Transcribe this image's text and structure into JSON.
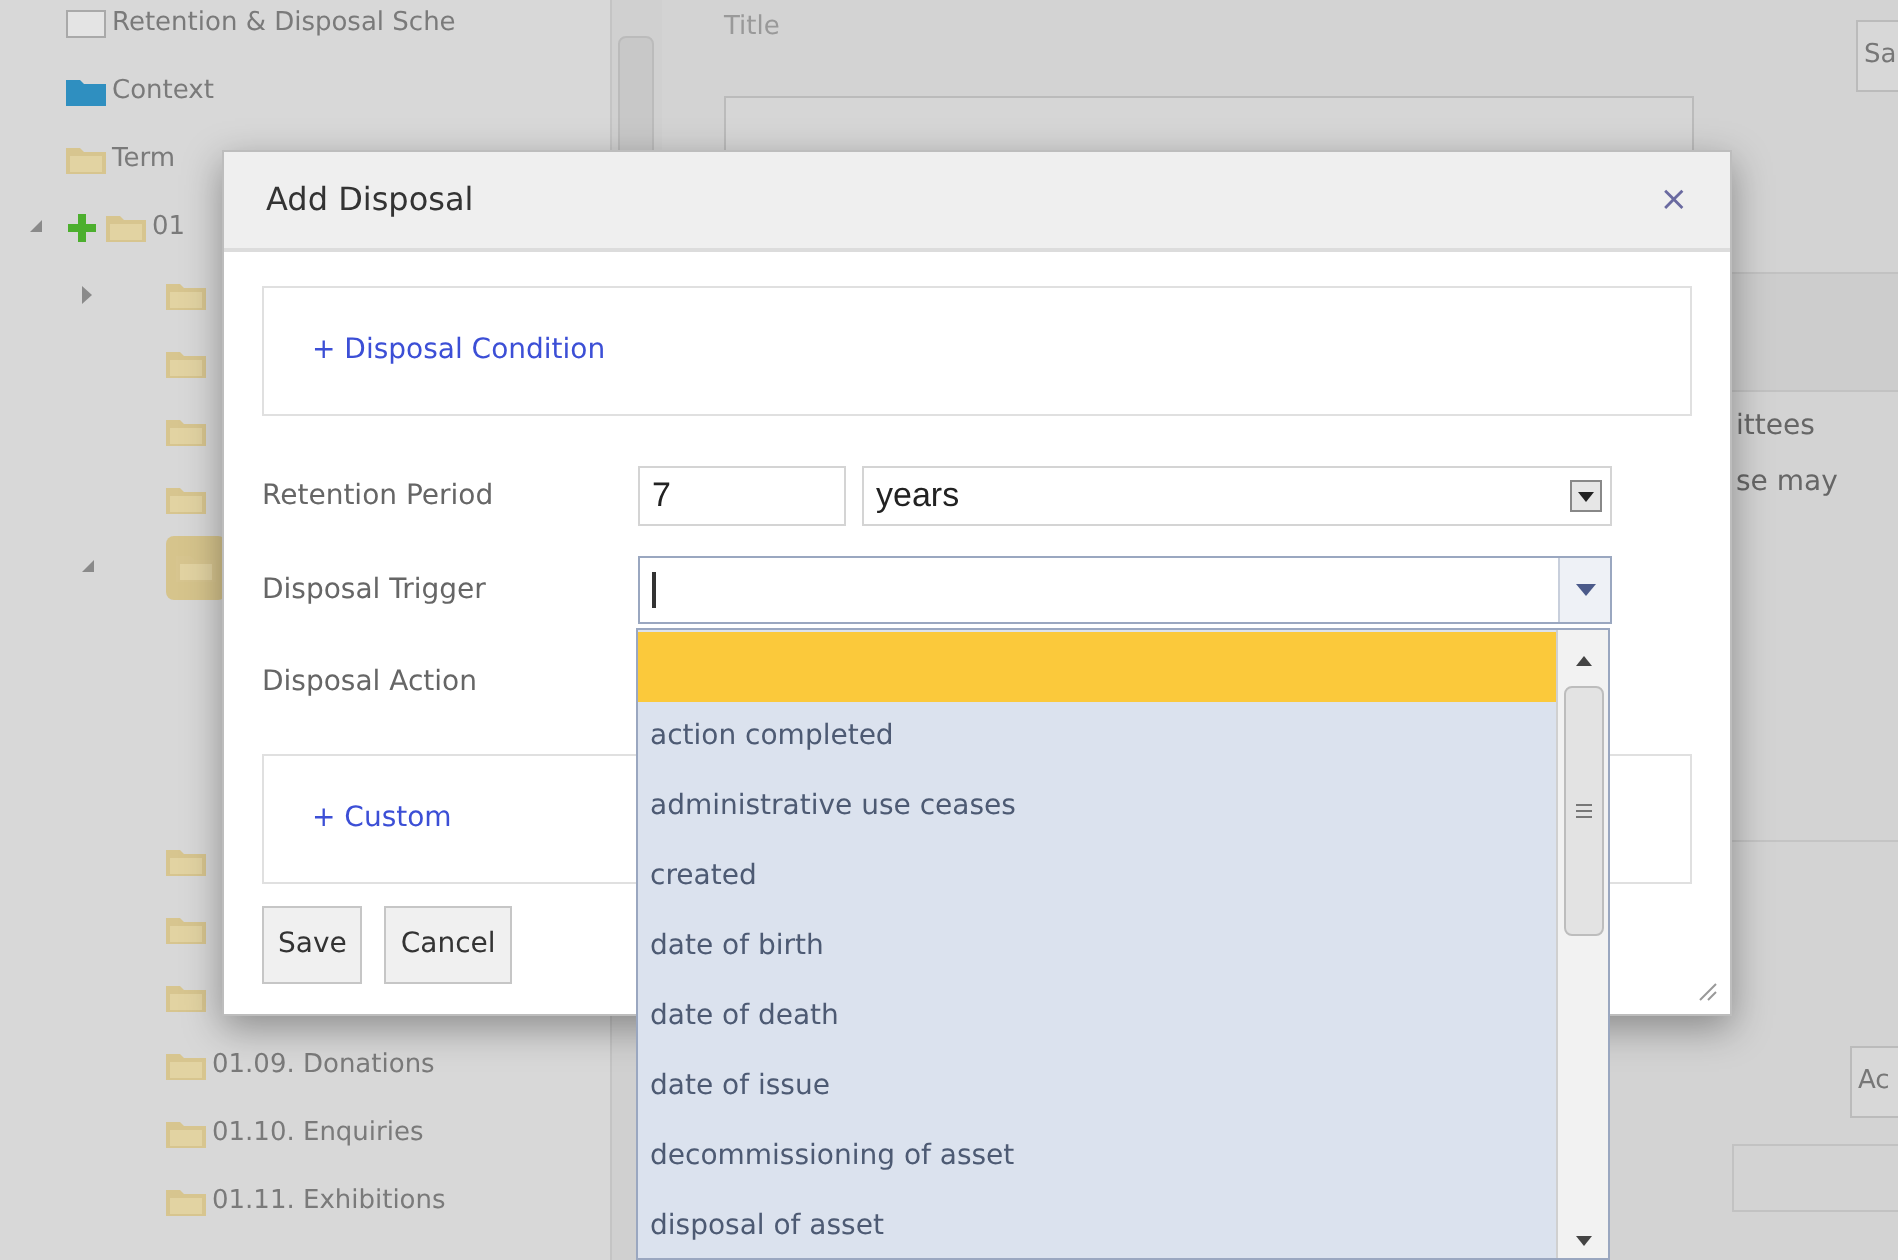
{
  "tree": [
    {
      "label": "Retention & Disposal Sche",
      "kind": "schedule"
    },
    {
      "label": "Context",
      "kind": "context"
    },
    {
      "label": "Term",
      "kind": "folder"
    },
    {
      "label": "01",
      "kind": "folder",
      "expanded": true,
      "add": true,
      "children": [
        {
          "kind": "folder",
          "expanded": false
        },
        {
          "kind": "folder"
        },
        {
          "kind": "folder"
        },
        {
          "kind": "folder"
        },
        {
          "kind": "folder",
          "expanded": true,
          "selected": true
        },
        {
          "kind": "folder"
        },
        {
          "kind": "folder"
        },
        {
          "kind": "folder"
        },
        {
          "label": "01.09. Donations",
          "kind": "folder"
        },
        {
          "label": "01.10. Enquiries",
          "kind": "folder"
        },
        {
          "label": "01.11. Exhibitions",
          "kind": "folder"
        }
      ]
    }
  ],
  "main": {
    "title_label": "Title",
    "top_button": "Sa",
    "text_lines": [
      "ittees",
      "se may"
    ],
    "bottom_button": "Ac"
  },
  "dialog": {
    "title": "Add Disposal",
    "close": "×",
    "condition_link": "+ Disposal Condition",
    "retention_label": "Retention Period",
    "retention_value": "7",
    "retention_unit": "years",
    "trigger_label": "Disposal Trigger",
    "action_label": "Disposal Action",
    "custom_link": "+ Custom",
    "buttons": [
      "Save",
      "Cancel"
    ]
  },
  "trigger_options": [
    {
      "selected": true
    },
    {
      "label": "action completed",
      "selected": false
    },
    {
      "label": "administrative use ceases",
      "selected": false
    },
    {
      "label": "created",
      "selected": false
    },
    {
      "label": "date of birth",
      "selected": false
    },
    {
      "label": "date of death",
      "selected": false
    },
    {
      "label": "date of issue",
      "selected": false
    },
    {
      "label": "decommissioning of asset",
      "selected": false
    },
    {
      "label": "disposal of asset",
      "selected": false
    }
  ]
}
